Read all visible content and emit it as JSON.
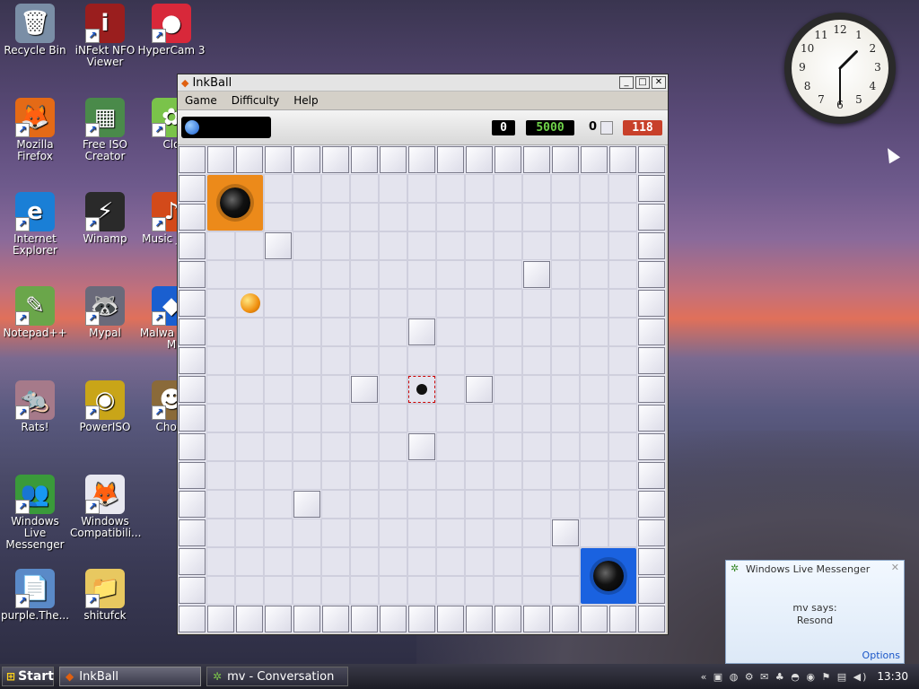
{
  "desktop": {
    "icons": [
      {
        "label": "Recycle Bin",
        "icon": "recycle-bin-icon",
        "color": "#7a8ea6",
        "glyph": "🗑"
      },
      {
        "label": "iNFekt NFO Viewer",
        "icon": "nfo-viewer-icon",
        "color": "#9a1e1e",
        "glyph": "i"
      },
      {
        "label": "HyperCam 3",
        "icon": "hypercam-icon",
        "color": "#d8283a",
        "glyph": "●"
      },
      {
        "label": "Mozilla Firefox",
        "icon": "firefox-icon",
        "color": "#e46a16",
        "glyph": "🦊"
      },
      {
        "label": "Free ISO Creator",
        "icon": "iso-creator-icon",
        "color": "#4a8a4a",
        "glyph": "▦"
      },
      {
        "label": "Clo",
        "icon": "cloud-icon",
        "color": "#7ac34a",
        "glyph": "✿"
      },
      {
        "label": "Internet Explorer",
        "icon": "internet-explorer-icon",
        "color": "#1a7fd6",
        "glyph": "e"
      },
      {
        "label": "Winamp",
        "icon": "winamp-icon",
        "color": "#2a2a2a",
        "glyph": "⚡"
      },
      {
        "label": "Music JUKE",
        "icon": "music-juke-icon",
        "color": "#d34a1a",
        "glyph": "♪"
      },
      {
        "label": "Notepad++",
        "icon": "notepad-plus-plus-icon",
        "color": "#6aa64a",
        "glyph": "✎"
      },
      {
        "label": "Mypal",
        "icon": "mypal-icon",
        "color": "#6a6a7a",
        "glyph": "🦝"
      },
      {
        "label": "Malwa Anti-M",
        "icon": "malware-icon",
        "color": "#1a5fd0",
        "glyph": "◆"
      },
      {
        "label": "Rats!",
        "icon": "rats-icon",
        "color": "#a67a8a",
        "glyph": "🐀"
      },
      {
        "label": "PowerISO",
        "icon": "poweriso-icon",
        "color": "#c9a518",
        "glyph": "◉"
      },
      {
        "label": "Chom",
        "icon": "chom-icon",
        "color": "#8a6a3a",
        "glyph": "☻"
      },
      {
        "label": "Windows Live Messenger",
        "icon": "messenger-icon",
        "color": "#3a9a3a",
        "glyph": "👥"
      },
      {
        "label": "Windows Compatibili...",
        "icon": "compat-icon",
        "color": "#e8e8f0",
        "glyph": "🦊"
      },
      {
        "label": "purple.The...",
        "icon": "document-icon",
        "color": "#5a8ac8",
        "glyph": "📄"
      },
      {
        "label": "shitufck",
        "icon": "folder-icon",
        "color": "#e8c860",
        "glyph": "📁"
      }
    ]
  },
  "clock": {
    "numbers": [
      "12",
      "1",
      "2",
      "3",
      "4",
      "5",
      "6",
      "7",
      "8",
      "9",
      "10",
      "11"
    ],
    "hour": 1,
    "minute": 30
  },
  "window": {
    "title": "InkBall",
    "menu": [
      "Game",
      "Difficulty",
      "Help"
    ],
    "status": {
      "score": "0",
      "target": "5000",
      "balls": "0",
      "time": "118"
    },
    "colors": {
      "goal_orange": "#ec8a1a",
      "goal_blue": "#1a62e0",
      "target": "#6fd24a",
      "time_bg": "#c8402a"
    }
  },
  "board": {
    "cols": 17,
    "rows": 17,
    "walls": [
      [
        3,
        3
      ],
      [
        12,
        4
      ],
      [
        8,
        6
      ],
      [
        6,
        8
      ],
      [
        10,
        8
      ],
      [
        8,
        10
      ],
      [
        4,
        12
      ],
      [
        13,
        13
      ]
    ],
    "goals": [
      {
        "col": 1,
        "row": 1,
        "color": "orange"
      },
      {
        "col": 14,
        "row": 14,
        "color": "blue"
      }
    ],
    "ball": {
      "col": 2,
      "row": 5
    },
    "spawner": {
      "col": 8,
      "row": 8
    }
  },
  "messenger": {
    "title": "Windows Live Messenger",
    "line1": "mv says:",
    "line2": "Resond",
    "options": "Options"
  },
  "taskbar": {
    "start": "Start",
    "tasks": [
      "InkBall",
      "mv - Conversation"
    ],
    "time": "13:30",
    "tray_icons": "« ▣ ◍ ⚙ ✉ ♣ ◓ ◉ ⚑ ▤ ◀)"
  }
}
